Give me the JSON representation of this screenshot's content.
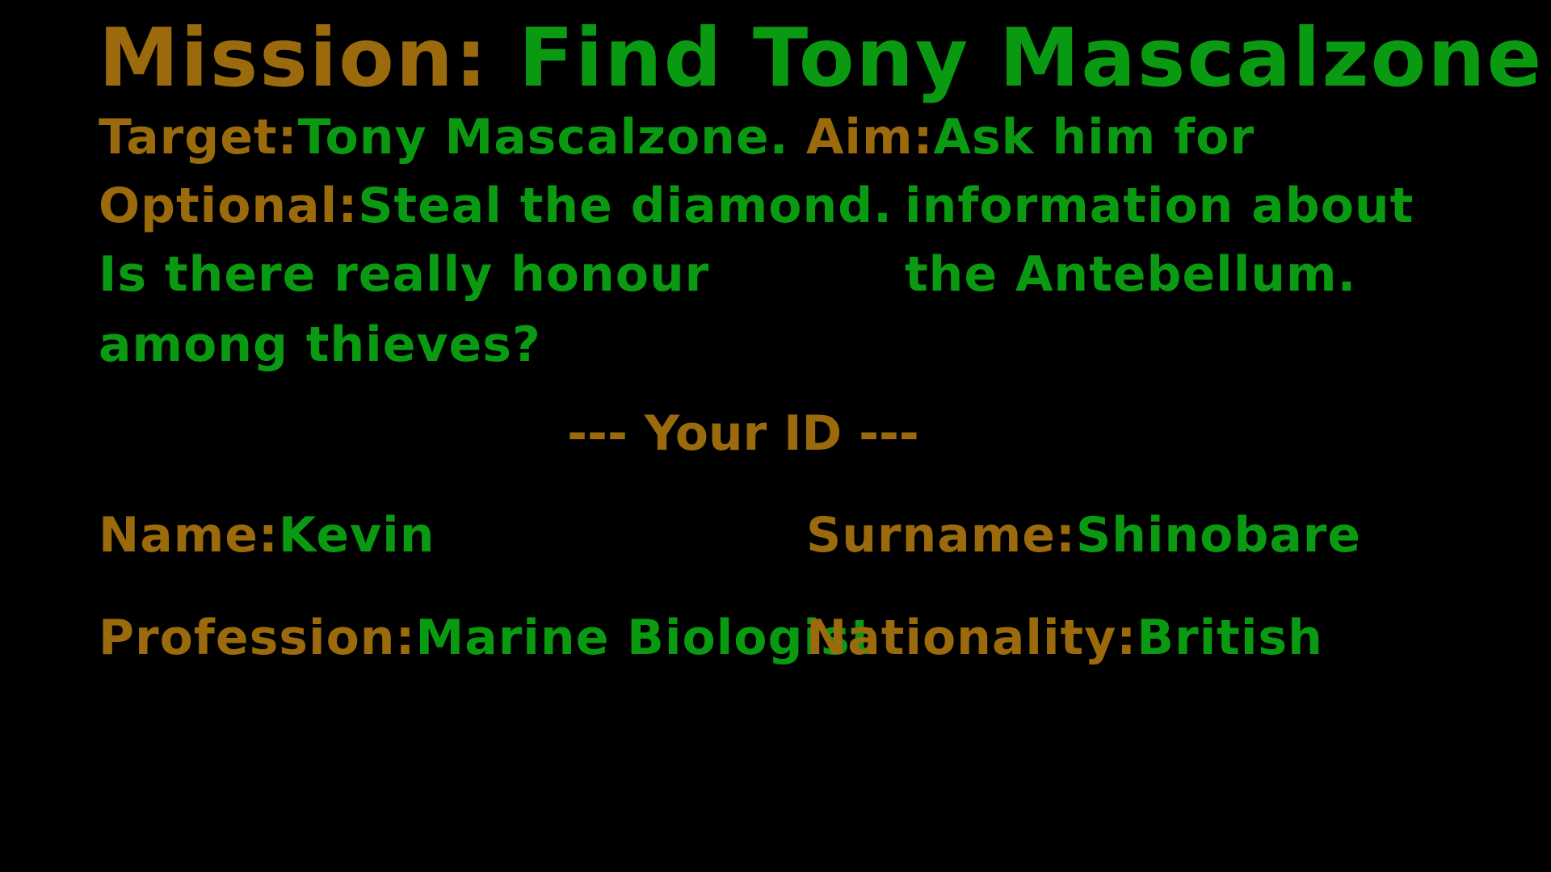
{
  "mission": {
    "label": "Mission:",
    "value": "Find Tony Mascalzone."
  },
  "target": {
    "label": "Target:",
    "value": "Tony Mascalzone."
  },
  "aim": {
    "label": "Aim:",
    "lines": [
      "Ask him for",
      "information about",
      "the Antebellum."
    ]
  },
  "optional": {
    "label": "Optional:",
    "lines": [
      "Steal the diamond.",
      "Is there really honour",
      "among thieves?"
    ]
  },
  "id_heading": "--- Your ID ---",
  "identity": {
    "name_label": "Name:",
    "name_value": "Kevin",
    "surname_label": "Surname:",
    "surname_value": "Shinobare",
    "profession_label": "Profession:",
    "profession_value": "Marine Biologist",
    "nationality_label": "Nationality:",
    "nationality_value": "British"
  },
  "colors": {
    "background": "#000000",
    "label": "#9A6A0C",
    "value": "#0A9A12"
  }
}
